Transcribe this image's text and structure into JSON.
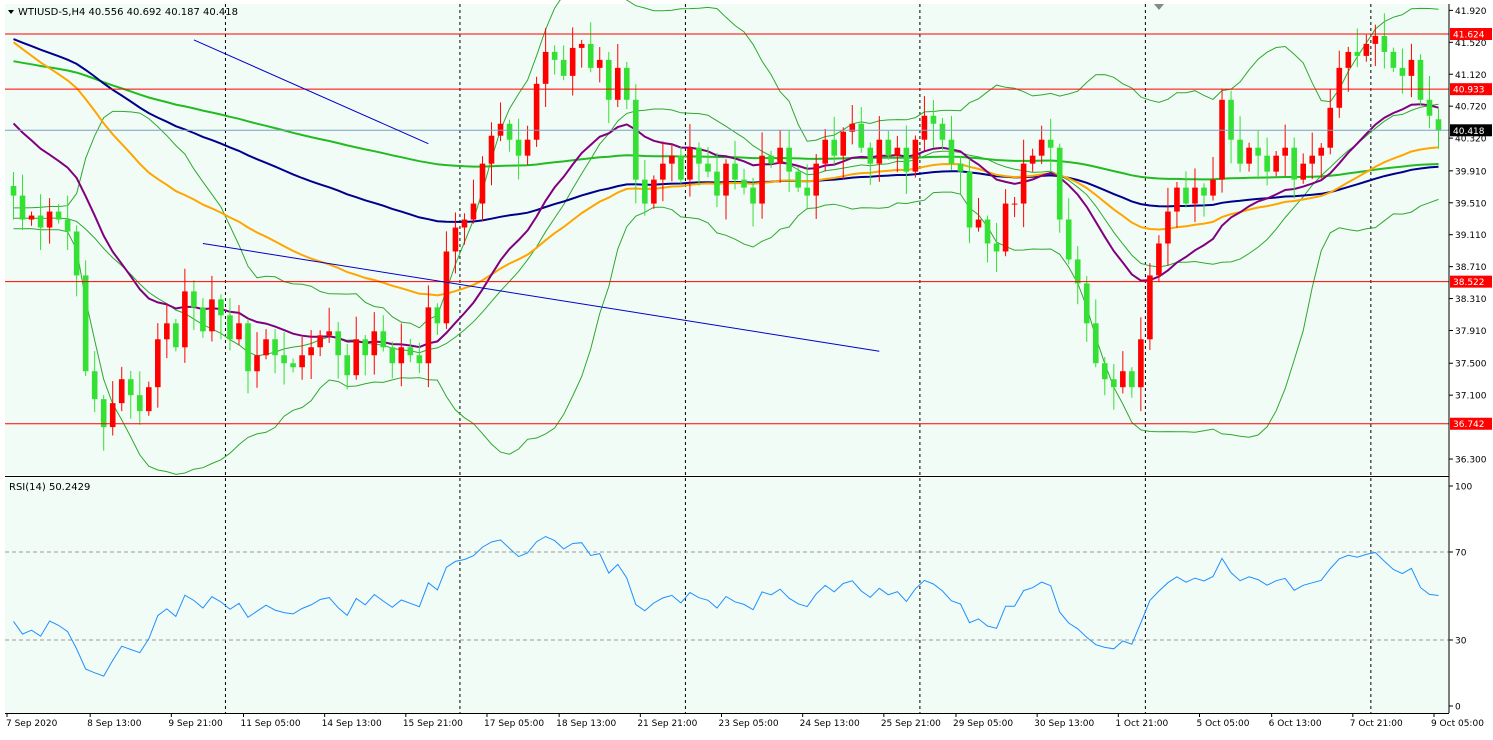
{
  "header": {
    "symbol_line": "WTIUSD-S,H4  40.556 40.692 40.187 40.418",
    "rsi_label": "RSI(14) 50.2429"
  },
  "colors": {
    "background": "#f2fcf6",
    "bull": "#ff0000",
    "bear": "#33e033",
    "hline": "#ff0000",
    "trendline": "#0000cc",
    "bollinger": "#2fa82f",
    "ma_purple": "#800080",
    "ma_orange": "#ffa500",
    "ma_navy": "#00008b",
    "ma_green": "#22bb22",
    "rsi": "#1e90ff"
  },
  "chart_data": [
    {
      "type": "candlestick",
      "symbol": "WTIUSD-S",
      "timeframe": "H4",
      "ohlc_last": {
        "open": 40.556,
        "high": 40.692,
        "low": 40.187,
        "close": 40.418
      },
      "ylim": [
        36.1,
        42.0
      ],
      "yticks": [
        "41.920",
        "41.520",
        "41.120",
        "40.720",
        "40.320",
        "39.910",
        "39.510",
        "39.110",
        "38.710",
        "38.310",
        "37.910",
        "37.500",
        "37.100",
        "36.300"
      ],
      "xticks": [
        "7 Sep 2020",
        "8 Sep 13:00",
        "9 Sep 21:00",
        "11 Sep 05:00",
        "14 Sep 13:00",
        "15 Sep 21:00",
        "17 Sep 05:00",
        "18 Sep 13:00",
        "21 Sep 21:00",
        "23 Sep 05:00",
        "24 Sep 13:00",
        "25 Sep 21:00",
        "29 Sep 05:00",
        "30 Sep 13:00",
        "1 Oct 21:00",
        "5 Oct 05:00",
        "6 Oct 13:00",
        "7 Oct 21:00",
        "9 Oct 05:00"
      ],
      "horizontal_levels": [
        41.624,
        40.933,
        38.522,
        36.742
      ],
      "current_price": 40.418,
      "trendlines": [
        {
          "from": [
            20,
            41.55
          ],
          "to": [
            46,
            40.25
          ]
        },
        {
          "from": [
            21,
            39.0
          ],
          "to": [
            96,
            37.65
          ]
        }
      ],
      "closes": [
        39.6,
        39.3,
        39.35,
        39.2,
        39.4,
        39.3,
        39.15,
        38.6,
        37.4,
        37.05,
        36.7,
        37.0,
        37.3,
        37.1,
        36.9,
        37.2,
        37.8,
        38.0,
        37.7,
        38.4,
        38.2,
        37.9,
        38.3,
        38.1,
        37.8,
        38.0,
        37.4,
        37.6,
        37.8,
        37.6,
        37.5,
        37.45,
        37.6,
        37.7,
        37.85,
        37.9,
        37.6,
        37.35,
        37.8,
        37.6,
        37.9,
        37.7,
        37.5,
        37.7,
        37.6,
        37.5,
        38.2,
        38.0,
        38.9,
        39.2,
        39.3,
        39.5,
        40.0,
        40.35,
        40.5,
        40.3,
        40.1,
        40.3,
        41.0,
        41.4,
        41.3,
        41.1,
        41.45,
        41.5,
        41.2,
        41.3,
        40.8,
        41.2,
        40.8,
        39.8,
        39.5,
        39.8,
        40.0,
        40.1,
        39.8,
        40.2,
        40.0,
        39.9,
        39.6,
        40.0,
        39.8,
        39.7,
        39.5,
        40.1,
        40.0,
        40.2,
        39.9,
        39.7,
        39.6,
        40.0,
        40.3,
        40.1,
        40.4,
        40.5,
        40.2,
        40.0,
        40.3,
        40.1,
        40.2,
        39.9,
        40.3,
        40.6,
        40.5,
        40.3,
        40.0,
        39.9,
        39.2,
        39.3,
        39.0,
        38.9,
        39.5,
        39.5,
        40.0,
        40.1,
        40.3,
        40.2,
        39.3,
        38.8,
        38.5,
        38.0,
        37.5,
        37.3,
        37.2,
        37.4,
        37.2,
        37.8,
        38.6,
        39.0,
        39.4,
        39.7,
        39.5,
        39.7,
        39.6,
        39.8,
        40.8,
        40.3,
        40.0,
        40.2,
        40.1,
        39.9,
        40.1,
        40.2,
        39.8,
        40.0,
        40.1,
        40.2,
        40.7,
        41.2,
        41.4,
        41.35,
        41.5,
        41.6,
        41.4,
        41.2,
        41.1,
        41.3,
        40.8,
        40.6,
        40.418
      ]
    },
    {
      "type": "line",
      "indicator": "RSI(14)",
      "value": 50.2429,
      "ylim": [
        0,
        100
      ],
      "yticks": [
        "100",
        "70",
        "30",
        "0"
      ],
      "levels": [
        70,
        30
      ]
    }
  ]
}
